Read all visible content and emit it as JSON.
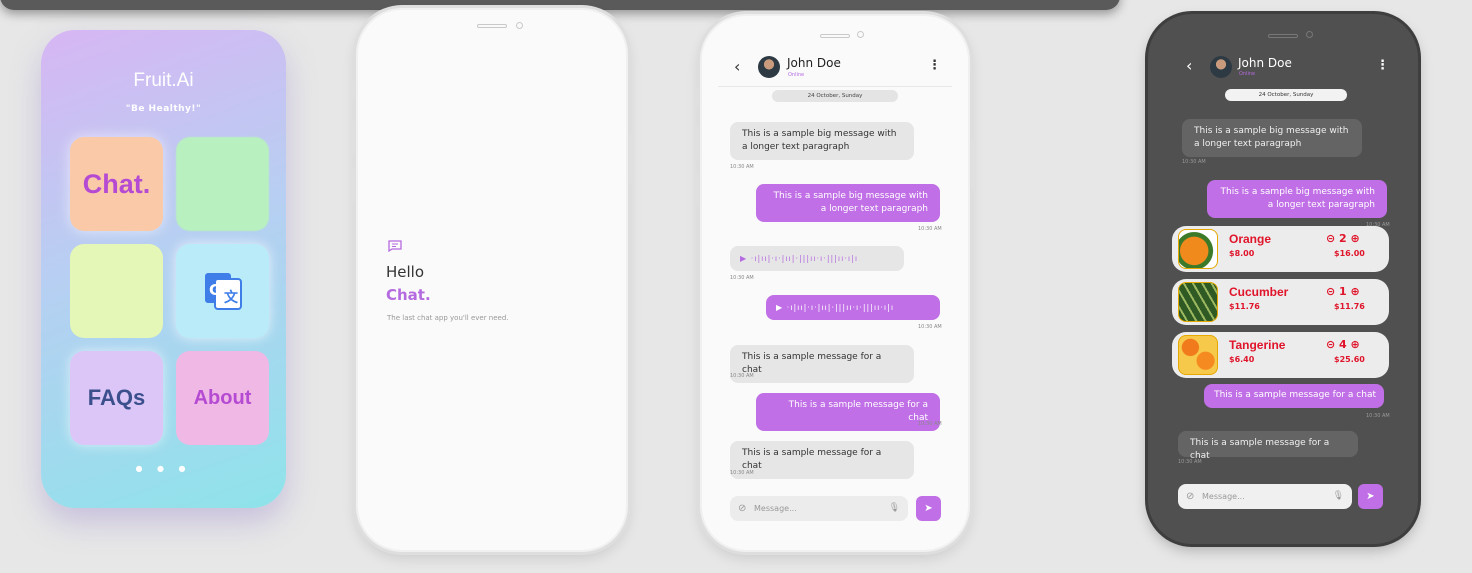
{
  "launcher": {
    "brand": "Fruit.Ai",
    "tagline": "\"Be Healthy!\"",
    "tiles": [
      "Chat.",
      "",
      "",
      "",
      "FAQs",
      "About"
    ],
    "translate_icon": "google-translate-icon",
    "dots": "● ● ●"
  },
  "splash": {
    "icon": "chat-icon",
    "hello": "Hello",
    "chat": "Chat.",
    "subtitle": "The last chat app you'll ever need."
  },
  "chat": {
    "back": "‹",
    "contact": "John Doe",
    "status": "Online",
    "menu": "⋮",
    "date": "24 October, Sunday",
    "msg_big": "This is a sample big message with a longer text paragraph",
    "msg": "This is a sample message for a chat",
    "time": "10:30 AM",
    "waveform": "▶  ·ı|ıı|·ı·|ıı|·|||ıı·ı·|||ıı·ı|ı",
    "input_placeholder": "Message...",
    "send": "➤",
    "clip": "⊘",
    "mic": "🎙"
  },
  "cart": {
    "items": [
      {
        "name": "Orange",
        "price": "$8.00",
        "qty": "⊝ 2 ⊕",
        "total": "$16.00"
      },
      {
        "name": "Cucumber",
        "price": "$11.76",
        "qty": "⊝ 1 ⊕",
        "total": "$11.76"
      },
      {
        "name": "Tangerine",
        "price": "$6.40",
        "qty": "⊝ 4 ⊕",
        "total": "$25.60"
      }
    ]
  },
  "colors": {
    "accent": "#c06fe6",
    "price_red": "#e0142a"
  }
}
